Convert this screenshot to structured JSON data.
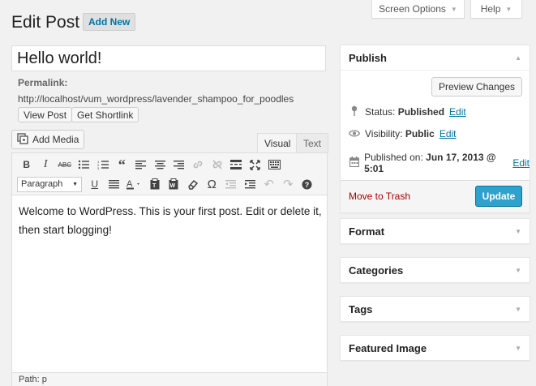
{
  "screen_meta": {
    "screen_options": "Screen Options",
    "help": "Help"
  },
  "header": {
    "title": "Edit Post",
    "add_new": "Add New"
  },
  "post": {
    "title": "Hello world!",
    "permalink_label": "Permalink:",
    "permalink_url": "http://localhost/vum_wordpress/lavender_shampoo_for_poodles",
    "view_post": "View Post",
    "get_shortlink": "Get Shortlink"
  },
  "editor": {
    "add_media": "Add Media",
    "tab_visual": "Visual",
    "tab_text": "Text",
    "format_select": "Paragraph",
    "content": "Welcome to WordPress. This is your first post. Edit or delete it, then start blogging!",
    "path": "Path: p"
  },
  "publish": {
    "title": "Publish",
    "preview_changes": "Preview Changes",
    "status_label": "Status:",
    "status_value": "Published",
    "visibility_label": "Visibility:",
    "visibility_value": "Public",
    "published_label": "Published on:",
    "published_value": "Jun 17, 2013 @ 5:01",
    "edit": "Edit",
    "move_to_trash": "Move to Trash",
    "update": "Update"
  },
  "boxes": {
    "format": "Format",
    "categories": "Categories",
    "tags": "Tags",
    "featured_image": "Featured Image"
  },
  "colors": {
    "accent": "#2ea2cc",
    "link": "#0074a2",
    "trash": "#a00000"
  }
}
